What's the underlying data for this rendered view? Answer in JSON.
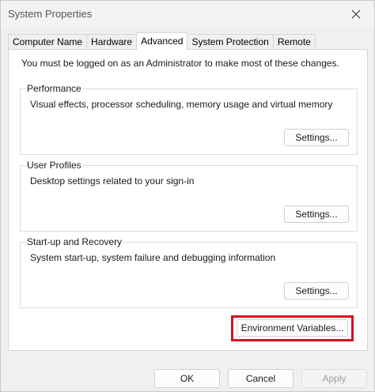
{
  "window": {
    "title": "System Properties"
  },
  "tabs": [
    {
      "label": "Computer Name",
      "active": false
    },
    {
      "label": "Hardware",
      "active": false
    },
    {
      "label": "Advanced",
      "active": true
    },
    {
      "label": "System Protection",
      "active": false
    },
    {
      "label": "Remote",
      "active": false
    }
  ],
  "panel": {
    "admin_note": "You must be logged on as an Administrator to make most of these changes.",
    "performance": {
      "title": "Performance",
      "description": "Visual effects, processor scheduling, memory usage and virtual memory",
      "button": "Settings..."
    },
    "user_profiles": {
      "title": "User Profiles",
      "description": "Desktop settings related to your sign-in",
      "button": "Settings..."
    },
    "startup_recovery": {
      "title": "Start-up and Recovery",
      "description": "System start-up, system failure and debugging information",
      "button": "Settings..."
    },
    "env_button": "Environment Variables..."
  },
  "footer": {
    "ok": "OK",
    "cancel": "Cancel",
    "apply": "Apply"
  },
  "colors": {
    "highlight": "#d6121e",
    "disabled_text": "#a0a0a0"
  }
}
